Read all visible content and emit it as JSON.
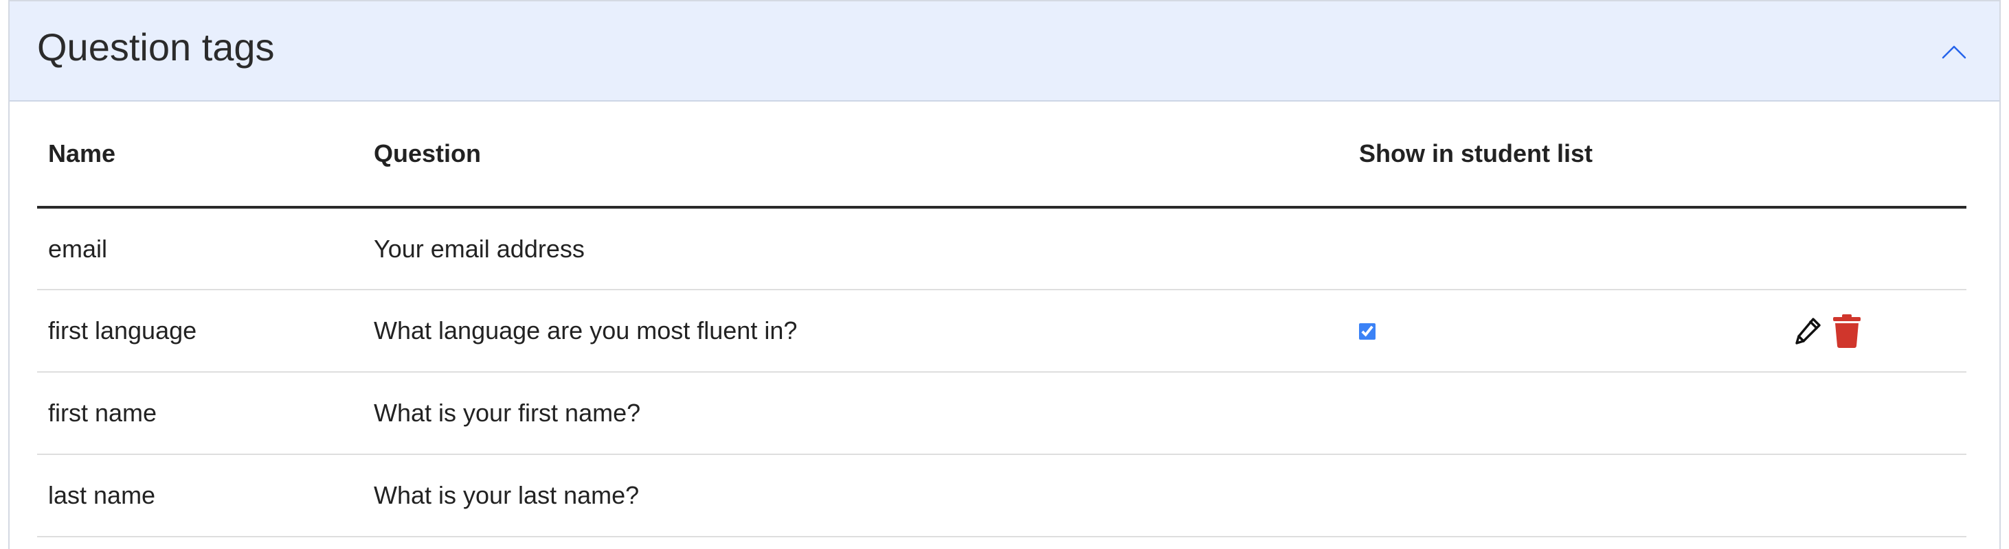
{
  "panel": {
    "title": "Question tags",
    "toggle_icon": "chevron-up-icon"
  },
  "table": {
    "columns": [
      "Name",
      "Question",
      "Show in student list",
      ""
    ],
    "rows": [
      {
        "name": "email",
        "question": "Your email address",
        "show_in_list": false,
        "has_actions": false
      },
      {
        "name": "first language",
        "question": "What language are you most fluent in?",
        "show_in_list": true,
        "has_actions": true
      },
      {
        "name": "first name",
        "question": "What is your first name?",
        "show_in_list": false,
        "has_actions": false
      },
      {
        "name": "last name",
        "question": "What is your last name?",
        "show_in_list": false,
        "has_actions": false
      }
    ]
  },
  "icons": {
    "edit": "pencil-icon",
    "delete": "trash-icon"
  },
  "colors": {
    "header_bg": "#e8effd",
    "accent": "#2563eb",
    "delete": "#d0362c",
    "checkbox": "#3b82f6"
  }
}
